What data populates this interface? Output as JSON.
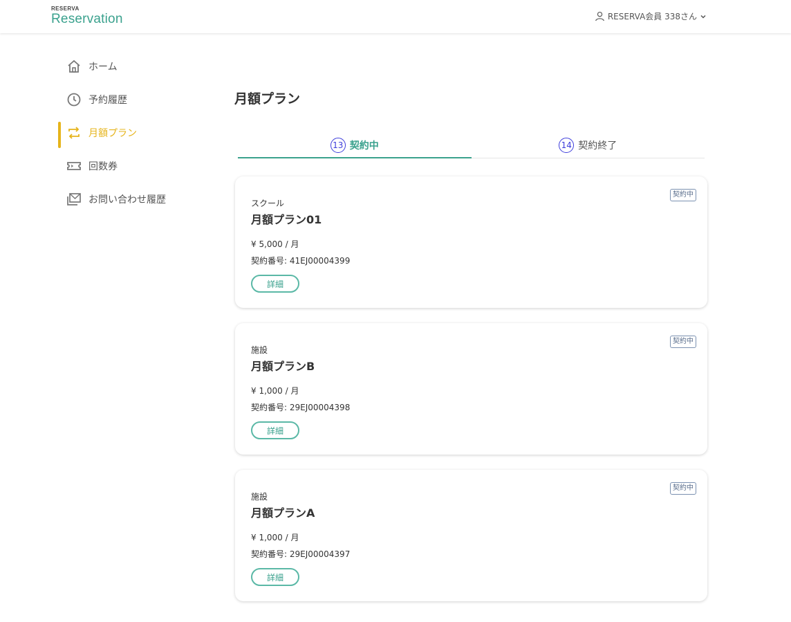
{
  "header": {
    "logo_small": "RESERVA",
    "logo_big": "Reservation",
    "user_label": "RESERVA会員 338さん"
  },
  "sidebar": {
    "items": [
      {
        "label": "ホーム",
        "icon": "home-icon"
      },
      {
        "label": "予約履歴",
        "icon": "clock-icon"
      },
      {
        "label": "月額プラン",
        "icon": "repeat-icon",
        "active": true
      },
      {
        "label": "回数券",
        "icon": "ticket-icon"
      },
      {
        "label": "お問い合わせ履歴",
        "icon": "mail-history-icon"
      }
    ]
  },
  "main": {
    "title": "月額プラン",
    "tabs": [
      {
        "count": "13",
        "label": "契約中",
        "active": true
      },
      {
        "count": "14",
        "label": "契約終了",
        "active": false
      }
    ],
    "cards": [
      {
        "badge": "契約中",
        "category": "スクール",
        "name": "月額プラン01",
        "price": "¥ 5,000 / 月",
        "contract": "契約番号: 41EJ00004399",
        "button": "詳細"
      },
      {
        "badge": "契約中",
        "category": "施設",
        "name": "月額プランB",
        "price": "¥ 1,000 / 月",
        "contract": "契約番号: 29EJ00004398",
        "button": "詳細"
      },
      {
        "badge": "契約中",
        "category": "施設",
        "name": "月額プランA",
        "price": "¥ 1,000 / 月",
        "contract": "契約番号: 29EJ00004397",
        "button": "詳細"
      }
    ]
  },
  "colors": {
    "brand": "#3aa18d",
    "active_nav": "#e6b41b",
    "tab_count": "#3d3ddb"
  }
}
